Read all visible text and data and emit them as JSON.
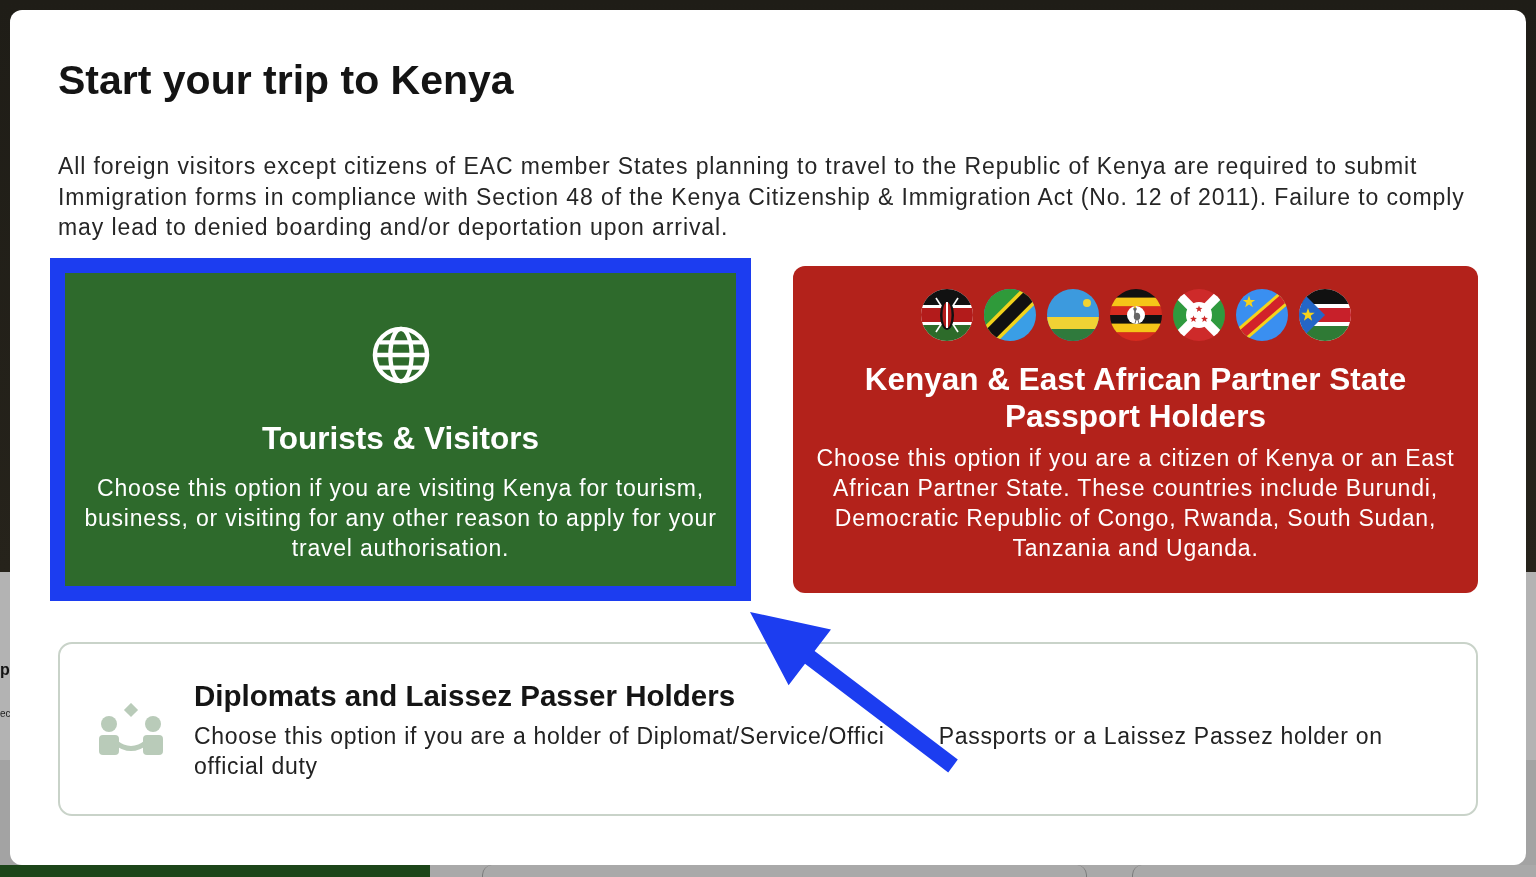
{
  "background": {
    "heading_fragment": "p",
    "text_fragment": "ec"
  },
  "dialog": {
    "title": "Start your trip to Kenya",
    "intro": "All foreign visitors except citizens of EAC member States planning to travel to the Republic of Kenya are required to submit Immigration forms in compliance with Section 48 of the Kenya Citizenship & Immigration Act (No. 12 of 2011). Failure to comply may lead to denied boarding and/or deportation upon arrival.",
    "options": [
      {
        "kind": "tourist",
        "title": "Tourists & Visitors",
        "description": "Choose this option if you are visiting Kenya for tourism, business, or visiting for any other reason to apply for your travel authorisation.",
        "highlighted": true
      },
      {
        "kind": "partner",
        "title": "Kenyan & East African Partner State Passport Holders",
        "description": "Choose this option if you are a citizen of Kenya or an East African Partner State. These countries include Burundi, Democratic Republic of Congo, Rwanda, South Sudan, Tanzania and Uganda.",
        "highlighted": false
      },
      {
        "kind": "diplomat",
        "title": "Diplomats and Laissez Passer Holders",
        "description_parts": [
          "Choose this option if you are a holder of Diplomat/Service/Offici",
          "Passports or a Laissez Passez holder on official duty"
        ],
        "highlighted": false
      }
    ]
  },
  "annotation_arrow": true
}
